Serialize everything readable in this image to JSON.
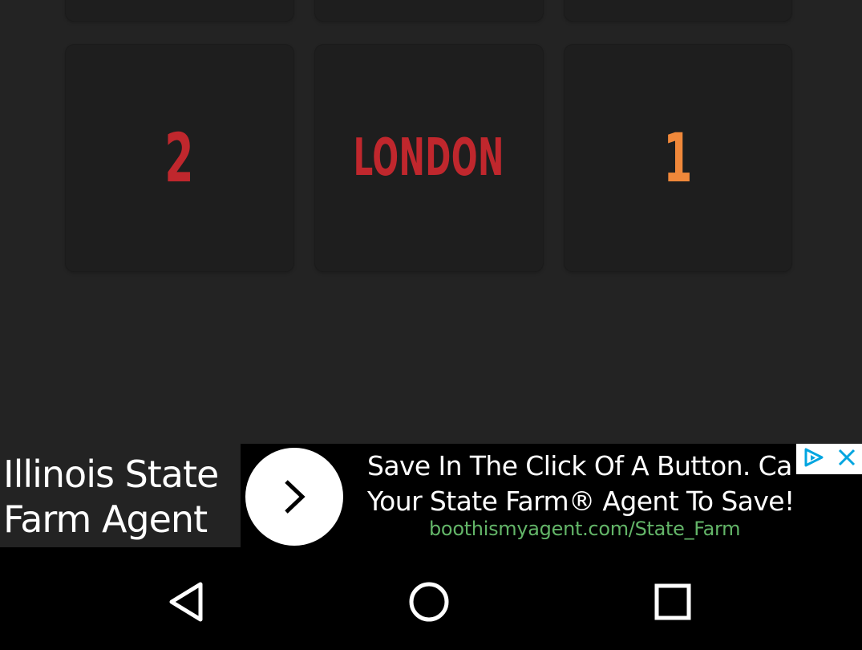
{
  "grid": {
    "top_row": [
      "",
      "",
      ""
    ],
    "tiles": [
      {
        "label": "2",
        "color": "#c0272d"
      },
      {
        "label": "LONDON",
        "color": "#c0272d"
      },
      {
        "label": "1",
        "color": "#f0883a"
      }
    ]
  },
  "ad": {
    "headline": "Illinois State Farm Agent",
    "arrow_icon": "chevron-right-icon",
    "body": "Save In The Click Of A Button. Call Your State Farm® Agent To Save!",
    "body_line1": "Save In The Click Of A Button. Ca",
    "body_line2": "Your State Farm® Agent To Save!",
    "url": "boothismyagent.com/State_Farm",
    "url_color": "#63b568",
    "adchoices_icon": "adchoices-icon",
    "close_icon": "close-icon",
    "accent": "#00a5e0"
  },
  "navbar": {
    "back_icon": "back-triangle-icon",
    "home_icon": "home-circle-icon",
    "recents_icon": "recents-square-icon"
  }
}
